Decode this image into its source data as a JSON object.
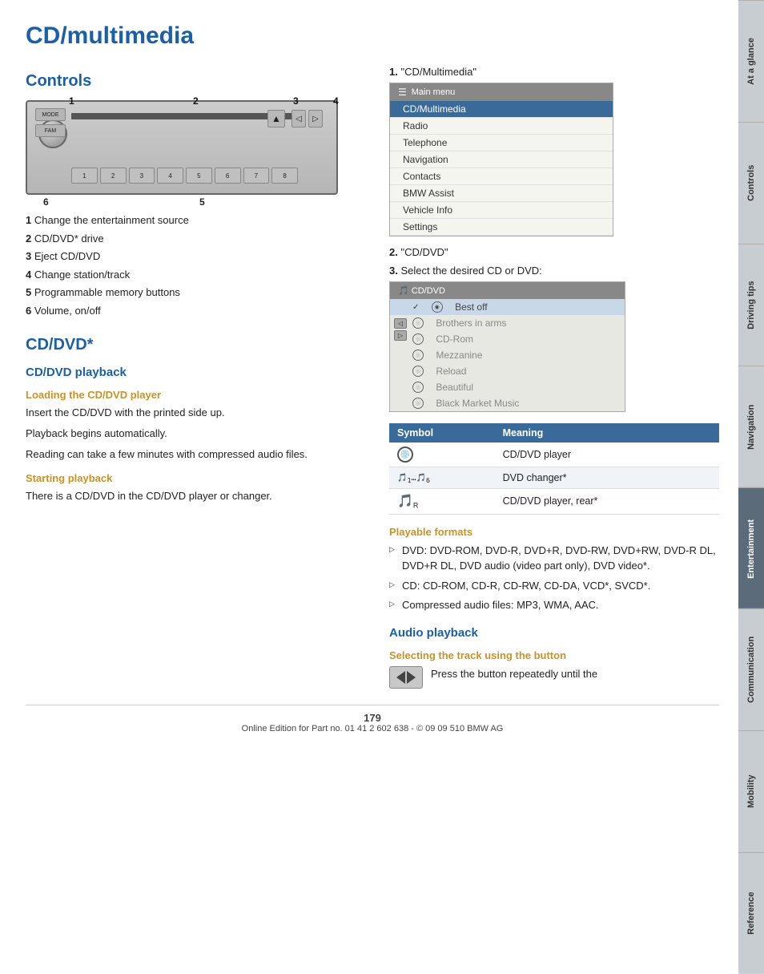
{
  "page": {
    "title": "CD/multimedia",
    "footer_text": "Online Edition for Part no. 01 41 2 602 638 - © 09 09 510 BMW AG",
    "page_number": "179"
  },
  "sidebar": {
    "tabs": [
      {
        "id": "at-a-glance",
        "label": "At a glance",
        "active": false
      },
      {
        "id": "controls",
        "label": "Controls",
        "active": false
      },
      {
        "id": "driving-tips",
        "label": "Driving tips",
        "active": false
      },
      {
        "id": "navigation",
        "label": "Navigation",
        "active": false
      },
      {
        "id": "entertainment",
        "label": "Entertainment",
        "active": true
      },
      {
        "id": "communication",
        "label": "Communication",
        "active": false
      },
      {
        "id": "mobility",
        "label": "Mobility",
        "active": false
      },
      {
        "id": "reference",
        "label": "Reference",
        "active": false
      }
    ]
  },
  "controls_section": {
    "heading": "Controls",
    "labels": {
      "1": "1",
      "2": "2",
      "3": "3",
      "4": "4",
      "5": "5",
      "6": "6"
    },
    "items": [
      {
        "num": "1",
        "text": "Change the entertainment source"
      },
      {
        "num": "2",
        "text": "CD/DVD* drive"
      },
      {
        "num": "3",
        "text": "Eject CD/DVD"
      },
      {
        "num": "4",
        "text": "Change station/track"
      },
      {
        "num": "5",
        "text": "Programmable memory buttons"
      },
      {
        "num": "6",
        "text": "Volume, on/off"
      }
    ]
  },
  "cd_dvd_section": {
    "heading": "CD/DVD*",
    "playback_heading": "CD/DVD playback",
    "loading_heading": "Loading the CD/DVD player",
    "loading_texts": [
      "Insert the CD/DVD with the printed side up.",
      "Playback begins automatically.",
      "Reading can take a few minutes with compressed audio files."
    ],
    "starting_heading": "Starting playback",
    "starting_text": "There is a CD/DVD in the CD/DVD player or changer."
  },
  "steps": {
    "step1": {
      "num": "1.",
      "text": "\"CD/Multimedia\""
    },
    "step2": {
      "num": "2.",
      "text": "\"CD/DVD\""
    },
    "step3": {
      "num": "3.",
      "text": "Select the desired CD or DVD:"
    }
  },
  "main_menu": {
    "header": "Main menu",
    "items": [
      {
        "label": "CD/Multimedia",
        "highlighted": true
      },
      {
        "label": "Radio",
        "highlighted": false
      },
      {
        "label": "Telephone",
        "highlighted": false
      },
      {
        "label": "Navigation",
        "highlighted": false
      },
      {
        "label": "Contacts",
        "highlighted": false
      },
      {
        "label": "BMW Assist",
        "highlighted": false
      },
      {
        "label": "Vehicle Info",
        "highlighted": false
      },
      {
        "label": "Settings",
        "highlighted": false
      }
    ]
  },
  "cddvd_menu": {
    "header": "CD/DVD",
    "items": [
      {
        "label": "Best off",
        "selected": true,
        "has_check": true
      },
      {
        "label": "Brothers in arms",
        "selected": false
      },
      {
        "label": "CD-Rom",
        "selected": false
      },
      {
        "label": "Mezzanine",
        "selected": false
      },
      {
        "label": "Reload",
        "selected": false
      },
      {
        "label": "Beautiful",
        "selected": false
      },
      {
        "label": "Black Market Music",
        "selected": false
      }
    ]
  },
  "symbol_table": {
    "col1": "Symbol",
    "col2": "Meaning",
    "rows": [
      {
        "symbol_type": "circle",
        "meaning": "CD/DVD player"
      },
      {
        "symbol_type": "range",
        "meaning": "DVD changer*"
      },
      {
        "symbol_type": "rear",
        "meaning": "CD/DVD player, rear*"
      }
    ]
  },
  "playable_formats": {
    "heading": "Playable formats",
    "items": [
      "DVD: DVD-ROM, DVD-R, DVD+R, DVD-RW, DVD+RW, DVD-R DL, DVD+R DL, DVD audio (video part only), DVD video*.",
      "CD: CD-ROM, CD-R, CD-RW, CD-DA, VCD*, SVCD*.",
      "Compressed audio files: MP3, WMA, AAC."
    ]
  },
  "audio_playback": {
    "heading": "Audio playback",
    "track_heading": "Selecting the track using the button",
    "track_text": "Press the button repeatedly until the"
  }
}
